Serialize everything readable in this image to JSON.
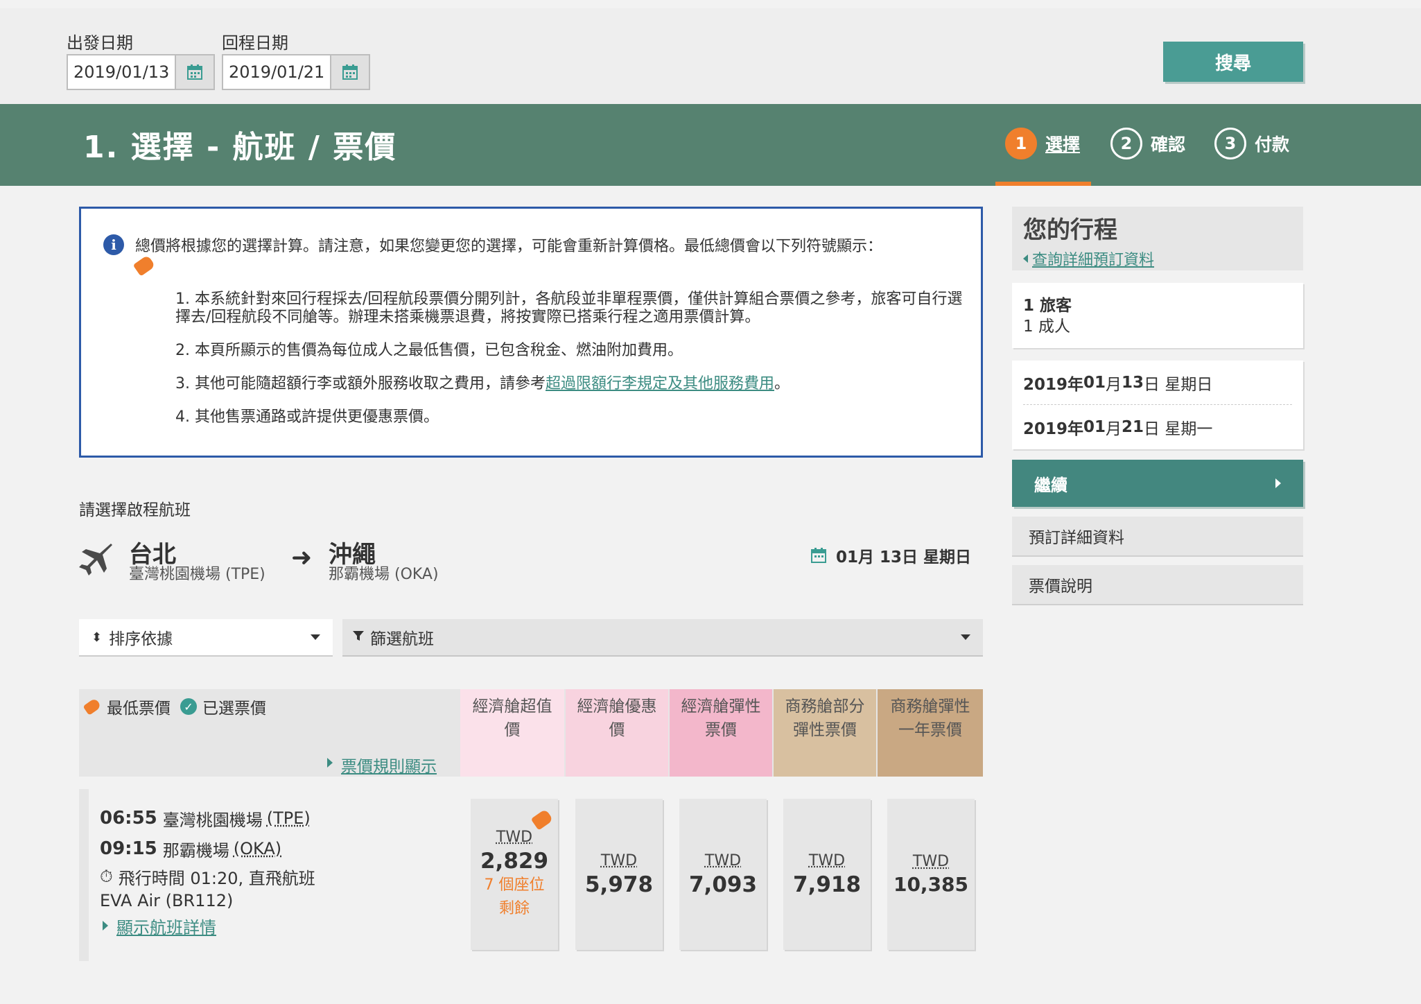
{
  "search": {
    "departure_label": "出發日期",
    "departure_value": "2019/01/13",
    "return_label": "回程日期",
    "return_value": "2019/01/21",
    "search_button": "搜尋"
  },
  "header": {
    "title": "1. 選擇 - 航班 / 票價",
    "steps": [
      {
        "num": "1",
        "label": "選擇",
        "active": true
      },
      {
        "num": "2",
        "label": "確認",
        "active": false
      },
      {
        "num": "3",
        "label": "付款",
        "active": false
      }
    ]
  },
  "notice": {
    "intro": "總價將根據您的選擇計算。請注意，如果您變更您的選擇，可能會重新計算價格。最低總價會以下列符號顯示：",
    "items": [
      "1. 本系統針對來回行程採去/回程航段票價分開列計，各航段並非單程票價，僅供計算組合票價之參考，旅客可自行選擇去/回程航段不同艙等。辦理未搭乘機票退費，將按實際已搭乘行程之適用票價計算。",
      "2. 本頁所顯示的售價為每位成人之最低售價，已包含稅金、燃油附加費用。"
    ],
    "item3_prefix": "3. 其他可能隨超額行李或額外服務收取之費用，請參考",
    "item3_link": "超過限額行李規定及其他服務費用",
    "item3_suffix": "。",
    "item4": "4. 其他售票通路或許提供更優惠票價。"
  },
  "outbound": {
    "label": "請選擇啟程航班",
    "from_city": "台北",
    "from_airport": "臺灣桃園機場 (TPE)",
    "to_city": "沖繩",
    "to_airport": "那霸機場 (OKA)",
    "date": "01月 13日 星期日"
  },
  "controls": {
    "sort_label": "排序依據",
    "filter_label": "篩選航班"
  },
  "fare_table": {
    "legend_lowest": "最低票價",
    "legend_selected": "已選票價",
    "rules_link": "票價規則顯示",
    "columns": [
      {
        "line1": "經濟艙超值",
        "line2": "價",
        "color": "#fbe1ea"
      },
      {
        "line1": "經濟艙優惠",
        "line2": "價",
        "color": "#f8d3df"
      },
      {
        "line1": "經濟艙彈性",
        "line2": "票價",
        "color": "#f3b7cb"
      },
      {
        "line1": "商務艙部分",
        "line2": "彈性票價",
        "color": "#d8c0a0"
      },
      {
        "line1": "商務艙彈性",
        "line2": "一年票價",
        "color": "#c9a883"
      }
    ]
  },
  "flight": {
    "depart_time": "06:55",
    "depart_airport": "臺灣桃園機場",
    "depart_code": "(TPE)",
    "arrive_time": "09:15",
    "arrive_airport": "那霸機場",
    "arrive_code": "(OKA)",
    "duration": "飛行時間 01:20, 直飛航班",
    "carrier": "EVA Air (BR112)",
    "details_link": "顯示航班詳情",
    "fares": [
      {
        "currency": "TWD",
        "amount": "2,829",
        "seats_line1": "7 個座位",
        "seats_line2": "剩餘",
        "lowest": true
      },
      {
        "currency": "TWD",
        "amount": "5,978"
      },
      {
        "currency": "TWD",
        "amount": "7,093"
      },
      {
        "currency": "TWD",
        "amount": "7,918"
      },
      {
        "currency": "TWD",
        "amount": "10,385"
      }
    ]
  },
  "sidebar": {
    "title": "您的行程",
    "details_link": "查詢詳細預訂資料",
    "travelers_label": "1 旅客",
    "travelers_value": "1 成人",
    "date1_prefix": "2019年 ",
    "date1_month": "01",
    "date1_mid": "月 ",
    "date1_day": "13",
    "date1_suffix": "日 星期日",
    "date2_prefix": "2019年 ",
    "date2_month": "01",
    "date2_mid": "月 ",
    "date2_day": "21",
    "date2_suffix": "日 星期一",
    "continue_button": "繼續",
    "booking_details": "預訂詳細資料",
    "fare_info": "票價說明"
  },
  "colors": {
    "accent": "#568270",
    "teal": "#4a9c94",
    "orange": "#f07f2c",
    "notice_border": "#2d5aa8"
  }
}
